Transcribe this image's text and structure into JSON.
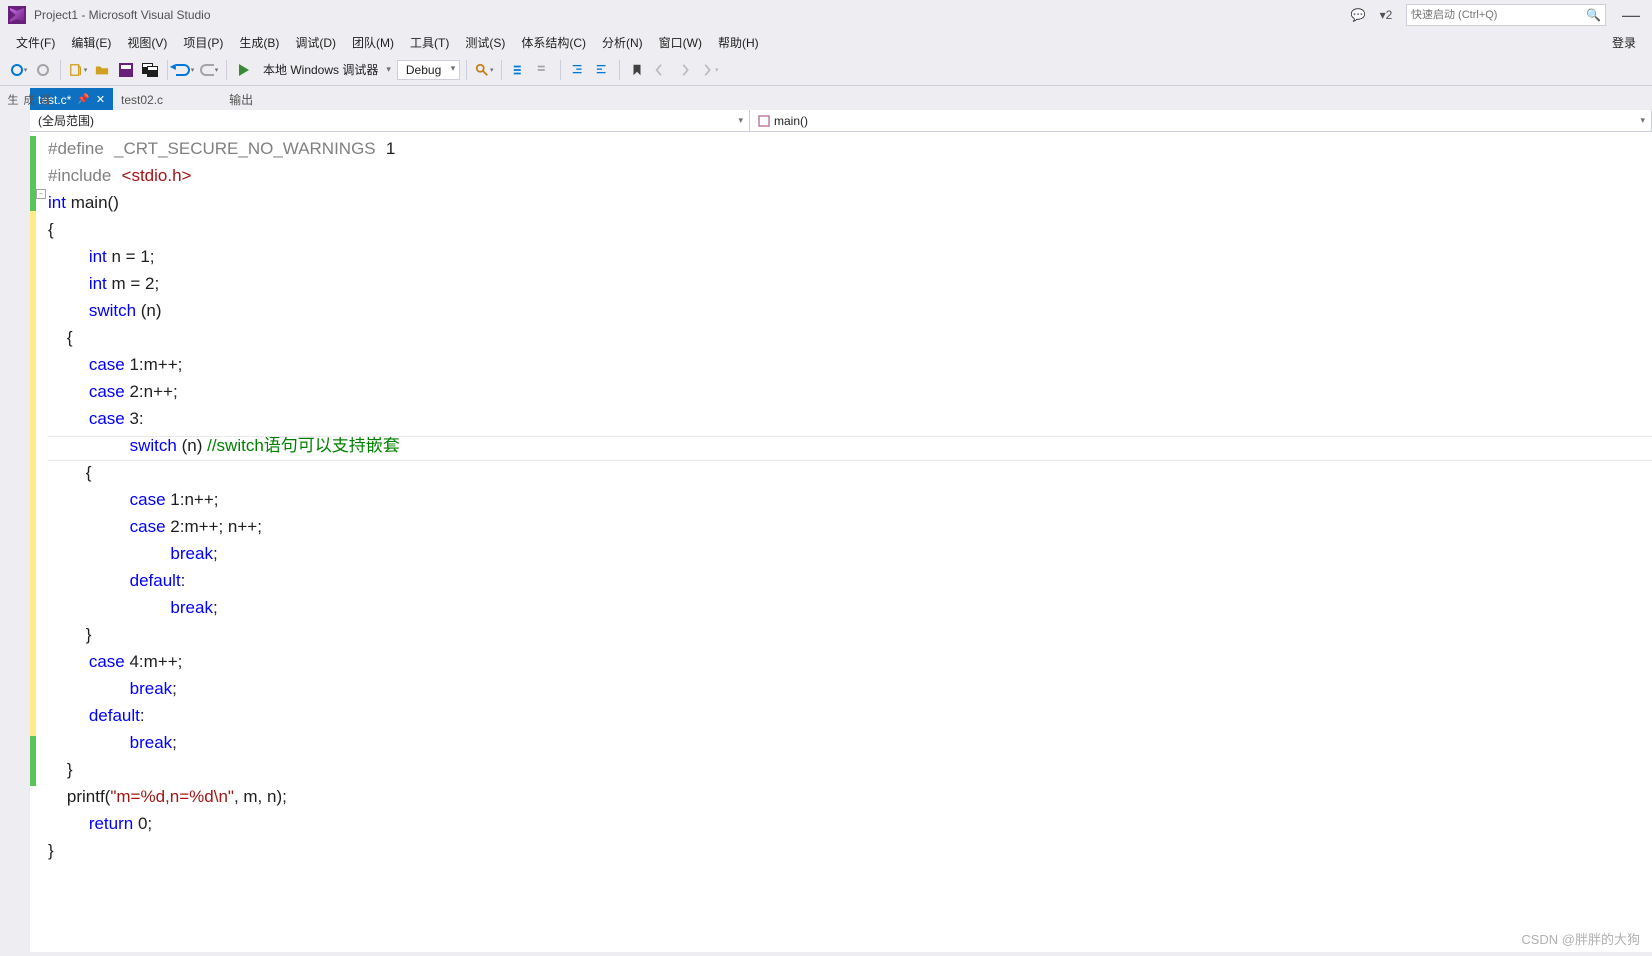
{
  "title": "Project1 - Microsoft Visual Studio",
  "notifications_count": "2",
  "search_placeholder": "快速启动 (Ctrl+Q)",
  "login_label": "登录",
  "menu": {
    "file": "文件(F)",
    "edit": "编辑(E)",
    "view": "视图(V)",
    "project": "项目(P)",
    "build": "生成(B)",
    "debug": "调试(D)",
    "team": "团队(M)",
    "tools": "工具(T)",
    "test": "测试(S)",
    "arch": "体系结构(C)",
    "analyze": "分析(N)",
    "window": "窗口(W)",
    "help": "帮助(H)"
  },
  "toolbar": {
    "debugger_label": "本地 Windows 调试器",
    "config": "Debug"
  },
  "side_panel_label": "生成器",
  "tabs": {
    "active": "test.c*",
    "second": "test02.c",
    "output": "输出"
  },
  "nav": {
    "scope": "(全局范围)",
    "member": "main()"
  },
  "code": {
    "l1_a": "#define",
    "l1_b": "_CRT_SECURE_NO_WARNINGS",
    "l1_c": "1",
    "l2_a": "#include",
    "l2_b": "<stdio.h>",
    "l3_a": "int",
    "l3_b": " main()",
    "l4": "{",
    "l5_a": "int",
    "l5_b": " n = 1;",
    "l6_a": "int",
    "l6_b": " m = 2;",
    "l7_a": "switch",
    "l7_b": " (n)",
    "l8": "    {",
    "l9_a": "case",
    "l9_b": " 1:m++;",
    "l10_a": "case",
    "l10_b": " 2:n++;",
    "l11_a": "case",
    "l11_b": " 3:",
    "l12_a": "switch",
    "l12_b": " (n) ",
    "l12_c": "//switch语句可以支持嵌套",
    "l13": "        {",
    "l14_a": "case",
    "l14_b": " 1:n++;",
    "l15_a": "case",
    "l15_b": " 2:m++; n++;",
    "l16_a": "break",
    "l16_b": ";",
    "l17_a": "default",
    "l17_b": ":",
    "l18_a": "break",
    "l18_b": ";",
    "l19": "        }",
    "l20_a": "case",
    "l20_b": " 4:m++;",
    "l21_a": "break",
    "l21_b": ";",
    "l22_a": "default",
    "l22_b": ":",
    "l23_a": "break",
    "l23_b": ";",
    "l24": "    }",
    "l25_a": "    printf(",
    "l25_b": "\"m=%d,n=%d\\n\"",
    "l25_c": ", m, n);",
    "l26_a": "return",
    "l26_b": " 0;",
    "l27": "}"
  },
  "watermark": "CSDN @胖胖的大狗"
}
